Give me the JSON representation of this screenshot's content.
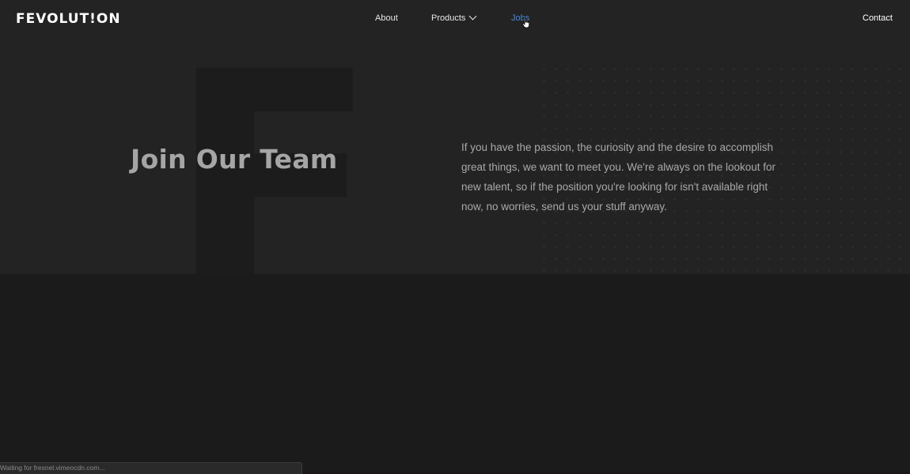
{
  "header": {
    "logo_text": "FEVOLUT!ON",
    "nav": {
      "about": "About",
      "products": "Products",
      "jobs": "Jobs",
      "contact": "Contact"
    }
  },
  "hero": {
    "watermark_letter": "F",
    "title": "Join Our Team",
    "paragraph": "If you have the passion, the curiosity and the desire to accomplish great things, we want to meet you. We're always on the lookout for new talent, so if the position you're looking for isn't available right now, no worries, send us your stuff anyway."
  },
  "browser_status": {
    "text": "Waiting for fresnel.vimeocdn.com..."
  },
  "colors": {
    "background": "#1b1b1c",
    "hero_background": "#232324",
    "active_nav": "#4a86d6",
    "title_text": "#a5a5a5"
  },
  "icons": {
    "products_dropdown": "chevron-down-icon",
    "cursor": "hand-pointer-icon"
  }
}
